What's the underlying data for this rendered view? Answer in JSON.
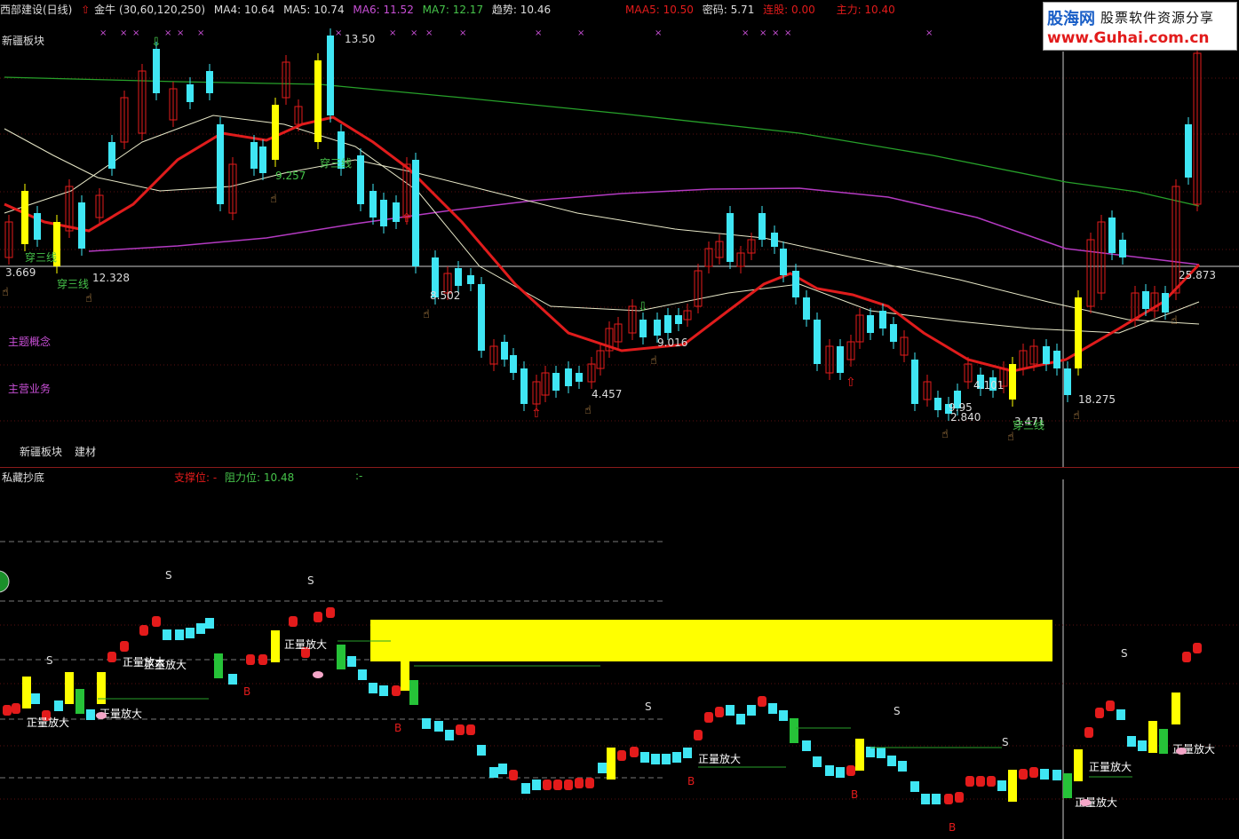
{
  "header": {
    "stock": "西部建设(日线)",
    "indicator_name": "金牛",
    "indicator_params": "(30,60,120,250)",
    "ma4": "MA4: 10.64",
    "ma5": "MA5: 10.74",
    "ma6": "MA6: 11.52",
    "ma7": "MA7: 12.17",
    "trend": "趋势: 10.46",
    "maa5": "MAA5: 10.50",
    "code": "密码: 5.71",
    "lianhu": "连股: 0.00",
    "zhuli": "主力: 10.40"
  },
  "logo": {
    "line1": "股海网",
    "line2": "股票软件资源分享",
    "line3": "www.Guhai.com.cn"
  },
  "upper_labels": {
    "sector": "新疆板块",
    "theme": "主题概念",
    "business": "主营业务",
    "footer_sector": "新疆板块",
    "footer_material": "建材"
  },
  "price_annotations": [
    {
      "text": "13.50"
    },
    {
      "text": "3.669"
    },
    {
      "text": "12.328"
    },
    {
      "text": "8.502"
    },
    {
      "text": "9.016"
    },
    {
      "text": "4.457"
    },
    {
      "text": "4.101"
    },
    {
      "text": "2.840"
    },
    {
      "text": "9.95"
    },
    {
      "text": "3.471"
    },
    {
      "text": "18.275"
    },
    {
      "text": "25.873"
    },
    {
      "text": "穿三线"
    },
    {
      "text": "穿三线"
    },
    {
      "text": "穿三线"
    },
    {
      "text": "穿三线"
    },
    {
      "text": "9.257"
    }
  ],
  "lower_panel": {
    "title": "私藏抄底",
    "support": "支撑位: -",
    "resistance": "阻力位: 10.48",
    "extra": ":-",
    "vol_label": "正量放大",
    "buy": "B",
    "sell": "S"
  },
  "colors": {
    "up": "#e31b1b",
    "down": "#3fe6f4",
    "ma_red": "#e01c1c",
    "ma_purple": "#b43ac2",
    "ma_green": "#27a12a",
    "yellow": "#ffff00"
  }
}
